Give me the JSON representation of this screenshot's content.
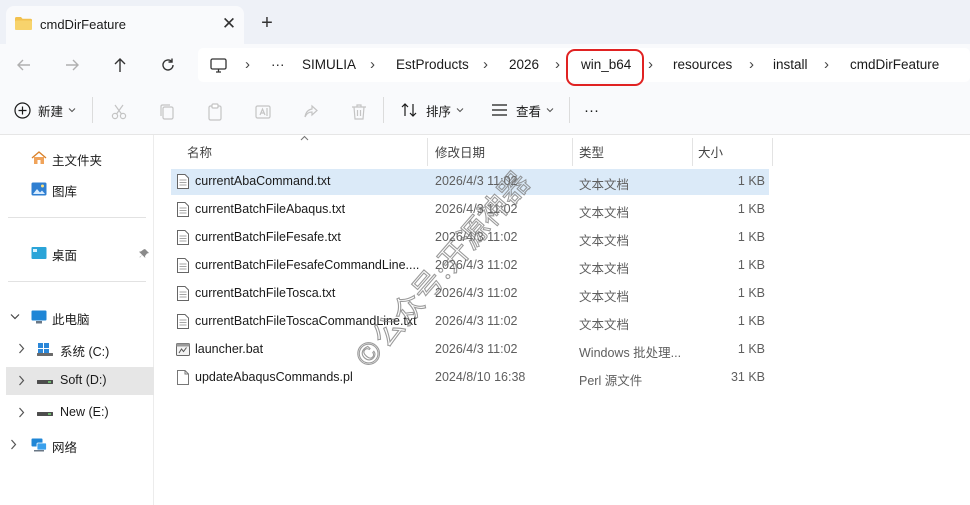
{
  "tab": {
    "title": "cmdDirFeature",
    "close": "✕",
    "new": "+"
  },
  "breadcrumb": {
    "overflow": "···",
    "items": [
      "SIMULIA",
      "EstProducts",
      "2026",
      "win_b64",
      "resources",
      "install",
      "cmdDirFeature"
    ],
    "separator": "›"
  },
  "toolbar": {
    "new_label": "新建",
    "sort_label": "排序",
    "view_label": "查看",
    "more": "···"
  },
  "sidebar": {
    "home": "主文件夹",
    "gallery": "图库",
    "desktop": "桌面",
    "this_pc": "此电脑",
    "drive_c": "系统 (C:)",
    "drive_d": "Soft (D:)",
    "drive_e": "New (E:)",
    "network": "网络"
  },
  "columns": {
    "name": "名称",
    "date": "修改日期",
    "type": "类型",
    "size": "大小"
  },
  "files": [
    {
      "name": "currentAbaCommand.txt",
      "date": "2026/4/3 11:02",
      "type": "文本文档",
      "size": "1 KB"
    },
    {
      "name": "currentBatchFileAbaqus.txt",
      "date": "2026/4/3 11:02",
      "type": "文本文档",
      "size": "1 KB"
    },
    {
      "name": "currentBatchFileFesafe.txt",
      "date": "2026/4/3 11:02",
      "type": "文本文档",
      "size": "1 KB"
    },
    {
      "name": "currentBatchFileFesafeCommandLine....",
      "date": "2026/4/3 11:02",
      "type": "文本文档",
      "size": "1 KB"
    },
    {
      "name": "currentBatchFileTosca.txt",
      "date": "2026/4/3 11:02",
      "type": "文本文档",
      "size": "1 KB"
    },
    {
      "name": "currentBatchFileToscaCommandLine.txt",
      "date": "2026/4/3 11:02",
      "type": "文本文档",
      "size": "1 KB"
    },
    {
      "name": "launcher.bat",
      "date": "2026/4/3 11:02",
      "type": "Windows 批处理...",
      "size": "1 KB"
    },
    {
      "name": "updateAbaqusCommands.pl",
      "date": "2024/8/10 16:38",
      "type": "Perl 源文件",
      "size": "31 KB"
    }
  ],
  "watermark": "©公众号:开源神器",
  "colors": {
    "highlight": "#e02222",
    "selected_row": "#dbeaf8",
    "folder": "#f2c14e"
  }
}
